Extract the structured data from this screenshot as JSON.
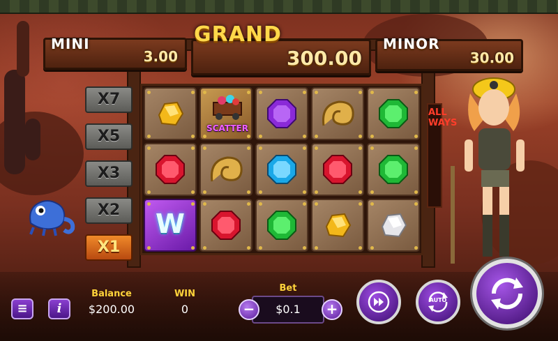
{
  "jackpots": {
    "mini": {
      "label": "MINI",
      "value": "3.00"
    },
    "grand": {
      "label": "GRAND",
      "value": "300.00"
    },
    "minor": {
      "label": "MINOR",
      "value": "30.00"
    }
  },
  "multipliers": [
    "X7",
    "X5",
    "X3",
    "X2",
    "X1"
  ],
  "active_multiplier": "X1",
  "side_banner": "ALL WAYS",
  "reels": [
    [
      "yellow-gem",
      "scatter",
      "purple-gem",
      "ammonite",
      "green-gem"
    ],
    [
      "red-gem",
      "ammonite",
      "blue-gem",
      "red-gem",
      "green-gem"
    ],
    [
      "wild",
      "red-gem",
      "green-gem",
      "yellow-gem",
      "white-gem"
    ]
  ],
  "symbols": {
    "scatter_label": "SCATTER",
    "wild_label": "W"
  },
  "bottom_bar": {
    "balance_label": "Balance",
    "balance_value": "$200.00",
    "win_label": "WIN",
    "win_value": "0",
    "bet_label": "Bet",
    "bet_value": "$0.1",
    "auto_label": "AUTO"
  },
  "colors": {
    "accent_purple": "#7b2fc0",
    "gold": "#ffd33a"
  }
}
